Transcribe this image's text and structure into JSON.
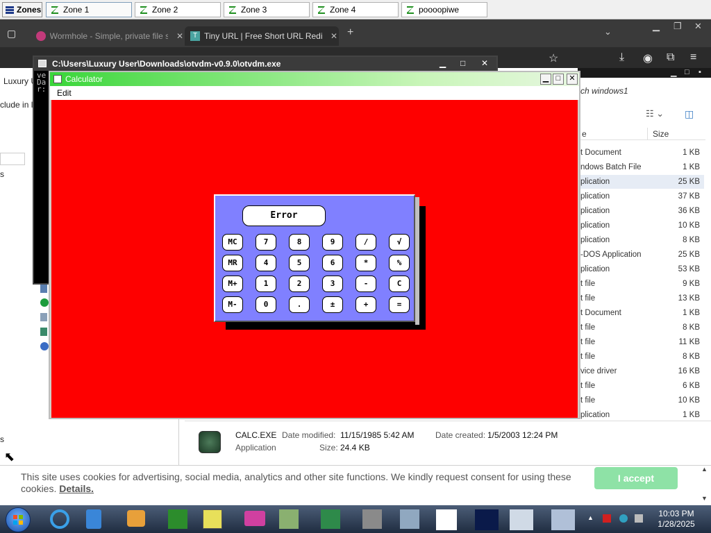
{
  "zones": {
    "menu_label": "Zones",
    "tabs": [
      "Zone 1",
      "Zone 2",
      "Zone 3",
      "Zone 4",
      "poooopiwe"
    ]
  },
  "browser": {
    "tabs": [
      {
        "title": "Wormhole - Simple, private file s"
      },
      {
        "title": "Tiny URL | Free Short URL Redirec"
      }
    ],
    "new_tab": "+"
  },
  "left_pane": {
    "frag1": "Luxury U",
    "frag2": "clude in l",
    "frag3": "s",
    "frag4": "s"
  },
  "console": {
    "title": "C:\\Users\\Luxury User\\Downloads\\otvdm-v0.9.0\\otvdm.exe",
    "lines": [
      "ve",
      "Da",
      "r:"
    ]
  },
  "calculator": {
    "title": "Calculator",
    "menu_edit": "Edit",
    "display": "Error",
    "keys": [
      [
        "MC",
        "7",
        "8",
        "9",
        "/",
        "√"
      ],
      [
        "MR",
        "4",
        "5",
        "6",
        "*",
        "%"
      ],
      [
        "M+",
        "1",
        "2",
        "3",
        "-",
        "C"
      ],
      [
        "M-",
        "0",
        ".",
        "±",
        "+",
        "="
      ]
    ]
  },
  "explorer": {
    "search_hint": "ch windows1",
    "size_header": "Size",
    "type_header": "e",
    "files": [
      {
        "type": "t Document",
        "size": "1 KB"
      },
      {
        "type": "ndows Batch File",
        "size": "1 KB"
      },
      {
        "type": "plication",
        "size": "25 KB"
      },
      {
        "type": "plication",
        "size": "37 KB"
      },
      {
        "type": "plication",
        "size": "36 KB"
      },
      {
        "type": "plication",
        "size": "10 KB"
      },
      {
        "type": "plication",
        "size": "8 KB"
      },
      {
        "type": "-DOS Application",
        "size": "25 KB"
      },
      {
        "type": "plication",
        "size": "53 KB"
      },
      {
        "type": "t file",
        "size": "9 KB"
      },
      {
        "type": "t file",
        "size": "13 KB"
      },
      {
        "type": "t Document",
        "size": "1 KB"
      },
      {
        "type": "t file",
        "size": "8 KB"
      },
      {
        "type": "t file",
        "size": "11 KB"
      },
      {
        "type": "t file",
        "size": "8 KB"
      },
      {
        "type": "vice driver",
        "size": "16 KB"
      },
      {
        "type": "t file",
        "size": "6 KB"
      },
      {
        "type": "t file",
        "size": "10 KB"
      },
      {
        "type": "plication",
        "size": "1 KB"
      }
    ],
    "details": {
      "name": "CALC.EXE",
      "kind": "Application",
      "modified_label": "Date modified:",
      "modified_value": "11/15/1985 5:42 AM",
      "created_label": "Date created:",
      "created_value": "1/5/2003 12:24 PM",
      "size_label": "Size:",
      "size_value": "24.4 KB"
    }
  },
  "cookie": {
    "text": "This site uses cookies for advertising, social media, analytics and other site functions. We kindly request consent for using these cookies.",
    "details": "Details.",
    "accept": "I accept"
  },
  "taskbar": {
    "time": "10:03 PM",
    "date": "1/28/2025"
  }
}
